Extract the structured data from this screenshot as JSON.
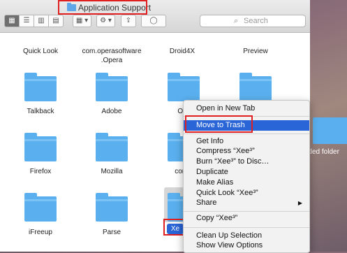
{
  "window": {
    "title": "Application Support",
    "search_placeholder": "Search"
  },
  "toolbar": {
    "view_icon": "icon-view",
    "list_icon": "list-view",
    "column_icon": "column-view",
    "coverflow_icon": "coverflow-view",
    "arrange_icon": "arrange-icon",
    "action_icon": "gear-icon",
    "share_icon": "share-icon",
    "tag_icon": "tag-icon"
  },
  "rows": [
    {
      "items": [
        "Quick Look",
        "com.operasoftware\n.Opera",
        "Droid4X",
        "Preview"
      ]
    },
    {
      "items": [
        "Talkback",
        "Adobe",
        "Ori",
        ""
      ]
    },
    {
      "items": [
        "Firefox",
        "Mozilla",
        "com.cra",
        ""
      ]
    },
    {
      "items": [
        "iFreeup",
        "Parse",
        "Xe",
        ""
      ]
    }
  ],
  "context_menu": {
    "items": [
      {
        "label": "Open in New Tab"
      },
      {
        "label": "Move to Trash",
        "highlighted": true
      },
      {
        "label": "Get Info"
      },
      {
        "label": "Compress “Xee³”"
      },
      {
        "label": "Burn “Xee³” to Disc…"
      },
      {
        "label": "Duplicate"
      },
      {
        "label": "Make Alias"
      },
      {
        "label": "Quick Look “Xee³”"
      },
      {
        "label": "Share",
        "submenu": true
      },
      {
        "label": "Copy “Xee³”"
      },
      {
        "label": "Clean Up Selection"
      },
      {
        "label": "Show View Options"
      }
    ]
  },
  "desktop": {
    "folder_label": "tled folder"
  },
  "colors": {
    "folder": "#5ab0ef",
    "highlight": "#2a65d8",
    "annotation": "#e02020"
  }
}
